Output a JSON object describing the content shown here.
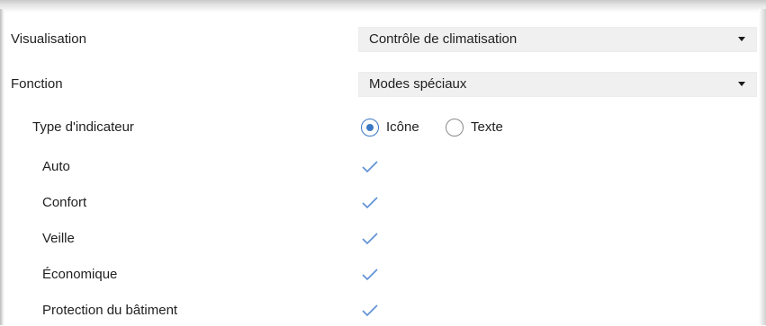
{
  "colors": {
    "accent": "#3b78c4",
    "check": "#5b8fd6",
    "select_bg": "#f0f0f0",
    "text": "#1f1f1f"
  },
  "rows": {
    "visualisation": {
      "label": "Visualisation",
      "selected": "Contrôle de climatisation"
    },
    "fonction": {
      "label": "Fonction",
      "selected": "Modes spéciaux"
    },
    "indicator_type": {
      "label": "Type d'indicateur",
      "options": [
        {
          "label": "Icône",
          "checked": true
        },
        {
          "label": "Texte",
          "checked": false
        }
      ]
    },
    "modes": [
      {
        "label": "Auto",
        "checked": true
      },
      {
        "label": "Confort",
        "checked": true
      },
      {
        "label": "Veille",
        "checked": true
      },
      {
        "label": "Économique",
        "checked": true
      },
      {
        "label": "Protection du bâtiment",
        "checked": true
      }
    ]
  },
  "icons": {
    "dropdown": "chevron-down-icon",
    "check": "checkmark-icon"
  }
}
